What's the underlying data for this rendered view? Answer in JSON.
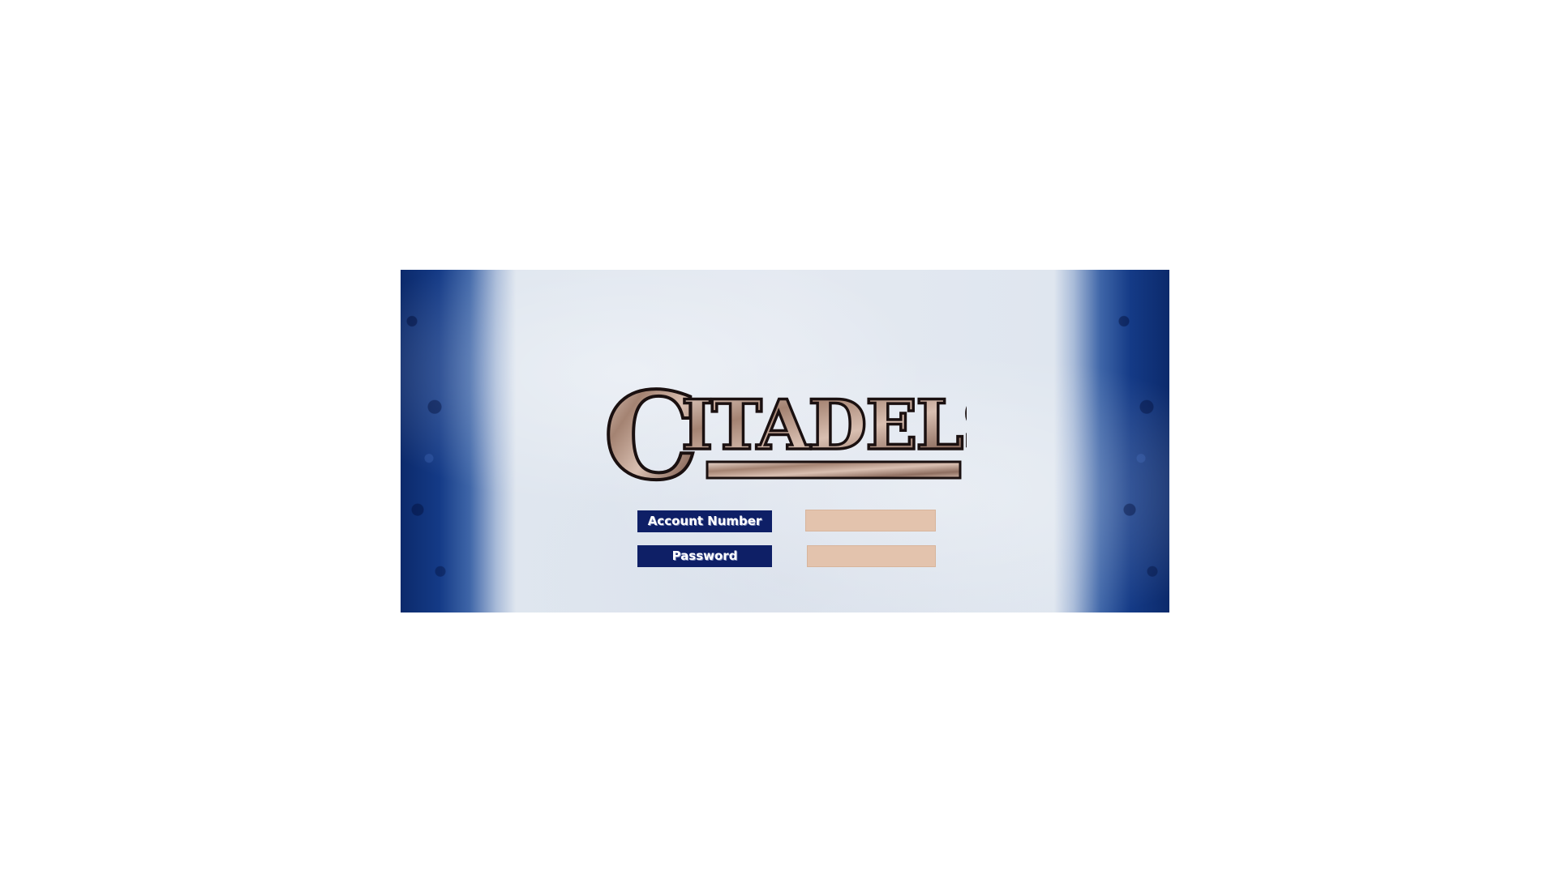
{
  "login": {
    "logo_text": "CITADELS",
    "account_label": "Account Number",
    "password_label": "Password",
    "account_value": "",
    "password_value": ""
  },
  "colors": {
    "label_background": "#0e1f66",
    "field_background": "#e3c3ad",
    "frame_edge_blue": "#0c2a6b",
    "frame_center": "#e4e9f1"
  }
}
